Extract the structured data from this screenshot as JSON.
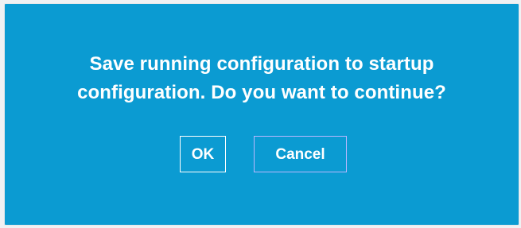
{
  "dialog": {
    "message_line1": "Save running configuration to startup",
    "message_line2": "configuration. Do you want to continue?",
    "ok_label": "OK",
    "cancel_label": "Cancel"
  },
  "colors": {
    "dialog_background": "#0b9bd2",
    "text": "#ffffff",
    "ok_border": "#ffffff",
    "cancel_border": "#b9b7ff"
  }
}
